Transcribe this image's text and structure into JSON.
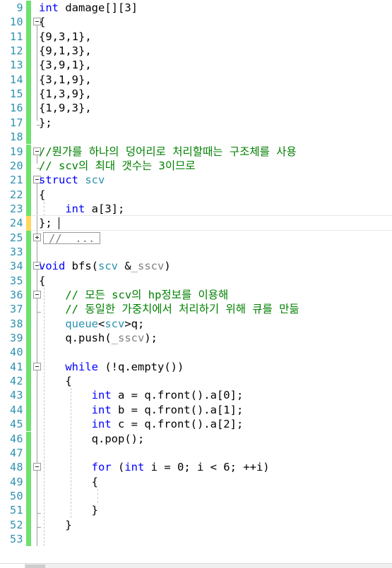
{
  "editor": {
    "first_line": 9,
    "line_height": 20.35,
    "colors": {
      "keyword": "#0000ff",
      "comment": "#008000",
      "type": "#2b91af",
      "parameter": "#808080",
      "text": "#000000",
      "line_number": "#2b91af",
      "change_saved": "#6ee26e",
      "change_unsaved": "#ffd75e",
      "background": "#ffffff"
    },
    "caret": {
      "line": 24,
      "column": 3
    },
    "scrollbar": {
      "orientation": "horizontal",
      "thumb_label": ""
    },
    "lines": [
      {
        "n": 9,
        "change": "green",
        "fold": null,
        "indent": 1,
        "tokens": [
          {
            "t": "int",
            "c": "kw"
          },
          {
            "t": " damage[][3]",
            "c": ""
          }
        ]
      },
      {
        "n": 10,
        "change": "green",
        "fold": "minus",
        "indent": 1,
        "tokens": [
          {
            "t": "{",
            "c": ""
          }
        ]
      },
      {
        "n": 11,
        "change": "green",
        "fold": null,
        "indent": 1,
        "tokens": [
          {
            "t": "{9,3,1},",
            "c": ""
          }
        ]
      },
      {
        "n": 12,
        "change": "green",
        "fold": null,
        "indent": 1,
        "tokens": [
          {
            "t": "{9,1,3},",
            "c": ""
          }
        ]
      },
      {
        "n": 13,
        "change": "green",
        "fold": null,
        "indent": 1,
        "tokens": [
          {
            "t": "{3,9,1},",
            "c": ""
          }
        ]
      },
      {
        "n": 14,
        "change": "green",
        "fold": null,
        "indent": 1,
        "tokens": [
          {
            "t": "{3,1,9},",
            "c": ""
          }
        ]
      },
      {
        "n": 15,
        "change": "green",
        "fold": null,
        "indent": 1,
        "tokens": [
          {
            "t": "{1,3,9},",
            "c": ""
          }
        ]
      },
      {
        "n": 16,
        "change": "green",
        "fold": null,
        "indent": 1,
        "tokens": [
          {
            "t": "{1,9,3},",
            "c": ""
          }
        ]
      },
      {
        "n": 17,
        "change": "green",
        "fold": "end",
        "indent": 1,
        "tokens": [
          {
            "t": "};",
            "c": ""
          }
        ]
      },
      {
        "n": 18,
        "change": "green",
        "fold": null,
        "indent": 0,
        "tokens": []
      },
      {
        "n": 19,
        "change": "green",
        "fold": "minus",
        "indent": 1,
        "tokens": [
          {
            "t": "//뭔가를 하나의 덩어리로 처리할때는 구조체를 사용",
            "c": "cm"
          }
        ]
      },
      {
        "n": 20,
        "change": "green",
        "fold": "end",
        "indent": 1,
        "tokens": [
          {
            "t": "// scv의 최대 갯수는 3이므로",
            "c": "cm"
          }
        ]
      },
      {
        "n": 21,
        "change": "green",
        "fold": "minus",
        "indent": 1,
        "tokens": [
          {
            "t": "struct",
            "c": "kw"
          },
          {
            "t": " ",
            "c": ""
          },
          {
            "t": "scv",
            "c": "ty"
          }
        ]
      },
      {
        "n": 22,
        "change": "green",
        "fold": null,
        "indent": 1,
        "tokens": [
          {
            "t": "{",
            "c": ""
          }
        ]
      },
      {
        "n": 23,
        "change": "green",
        "fold": null,
        "indent": 2,
        "tokens": [
          {
            "t": "    ",
            "c": ""
          },
          {
            "t": "int",
            "c": "kw"
          },
          {
            "t": " a[3];",
            "c": ""
          }
        ]
      },
      {
        "n": 24,
        "change": "yellow",
        "fold": null,
        "indent": 1,
        "current": true,
        "tokens": [
          {
            "t": "};",
            "c": ""
          }
        ]
      },
      {
        "n": 25,
        "change": "green",
        "fold": "plus",
        "indent": 0,
        "collapsed": "//  ...",
        "tokens": []
      },
      {
        "n": 33,
        "change": "green",
        "fold": null,
        "indent": 0,
        "tokens": []
      },
      {
        "n": 34,
        "change": "green",
        "fold": "minus",
        "indent": 1,
        "tokens": [
          {
            "t": "void",
            "c": "kw"
          },
          {
            "t": " bfs(",
            "c": ""
          },
          {
            "t": "scv",
            "c": "ty"
          },
          {
            "t": " &",
            "c": ""
          },
          {
            "t": "_sscv",
            "c": "pv"
          },
          {
            "t": ")",
            "c": ""
          }
        ]
      },
      {
        "n": 35,
        "change": "green",
        "fold": null,
        "indent": 1,
        "tokens": [
          {
            "t": "{",
            "c": ""
          }
        ]
      },
      {
        "n": 36,
        "change": "green",
        "fold": "minus",
        "indent": 2,
        "tokens": [
          {
            "t": "    ",
            "c": ""
          },
          {
            "t": "// 모든 scv의 hp정보를 이용해",
            "c": "cm"
          }
        ]
      },
      {
        "n": 37,
        "change": "green",
        "fold": "end",
        "indent": 2,
        "tokens": [
          {
            "t": "    ",
            "c": ""
          },
          {
            "t": "// 동일한 가중치에서 처리하기 위해 큐를 만듦",
            "c": "cm"
          }
        ]
      },
      {
        "n": 38,
        "change": "green",
        "fold": null,
        "indent": 2,
        "tokens": [
          {
            "t": "    ",
            "c": ""
          },
          {
            "t": "queue",
            "c": "ty"
          },
          {
            "t": "<",
            "c": ""
          },
          {
            "t": "scv",
            "c": "ty"
          },
          {
            "t": ">q;",
            "c": ""
          }
        ]
      },
      {
        "n": 39,
        "change": "green",
        "fold": null,
        "indent": 2,
        "tokens": [
          {
            "t": "    q.push(",
            "c": ""
          },
          {
            "t": "_sscv",
            "c": "pv"
          },
          {
            "t": ");",
            "c": ""
          }
        ]
      },
      {
        "n": 40,
        "change": "green",
        "fold": null,
        "indent": 2,
        "tokens": []
      },
      {
        "n": 41,
        "change": "green",
        "fold": "minus",
        "indent": 2,
        "tokens": [
          {
            "t": "    ",
            "c": ""
          },
          {
            "t": "while",
            "c": "kw"
          },
          {
            "t": " (!q.empty())",
            "c": ""
          }
        ]
      },
      {
        "n": 42,
        "change": "green",
        "fold": null,
        "indent": 2,
        "tokens": [
          {
            "t": "    {",
            "c": ""
          }
        ]
      },
      {
        "n": 43,
        "change": "green",
        "fold": null,
        "indent": 3,
        "tokens": [
          {
            "t": "        ",
            "c": ""
          },
          {
            "t": "int",
            "c": "kw"
          },
          {
            "t": " a = q.front().a[0];",
            "c": ""
          }
        ]
      },
      {
        "n": 44,
        "change": "green",
        "fold": null,
        "indent": 3,
        "tokens": [
          {
            "t": "        ",
            "c": ""
          },
          {
            "t": "int",
            "c": "kw"
          },
          {
            "t": " b = q.front().a[1];",
            "c": ""
          }
        ]
      },
      {
        "n": 45,
        "change": "green",
        "fold": null,
        "indent": 3,
        "tokens": [
          {
            "t": "        ",
            "c": ""
          },
          {
            "t": "int",
            "c": "kw"
          },
          {
            "t": " c = q.front().a[2];",
            "c": ""
          }
        ]
      },
      {
        "n": 46,
        "change": "green",
        "fold": null,
        "indent": 3,
        "tokens": [
          {
            "t": "        q.pop();",
            "c": ""
          }
        ]
      },
      {
        "n": 47,
        "change": "green",
        "fold": null,
        "indent": 3,
        "tokens": []
      },
      {
        "n": 48,
        "change": "green",
        "fold": "minus",
        "indent": 3,
        "tokens": [
          {
            "t": "        ",
            "c": ""
          },
          {
            "t": "for",
            "c": "kw"
          },
          {
            "t": " (",
            "c": ""
          },
          {
            "t": "int",
            "c": "kw"
          },
          {
            "t": " i = 0; i < 6; ++i)",
            "c": ""
          }
        ]
      },
      {
        "n": 49,
        "change": "green",
        "fold": null,
        "indent": 3,
        "tokens": [
          {
            "t": "        {",
            "c": ""
          }
        ]
      },
      {
        "n": 50,
        "change": "green",
        "fold": null,
        "indent": 4,
        "tokens": []
      },
      {
        "n": 51,
        "change": "green",
        "fold": "end",
        "indent": 3,
        "tokens": [
          {
            "t": "        }",
            "c": ""
          }
        ]
      },
      {
        "n": 52,
        "change": "green",
        "fold": "end",
        "indent": 2,
        "tokens": [
          {
            "t": "    }",
            "c": ""
          }
        ]
      },
      {
        "n": 53,
        "change": "green",
        "fold": null,
        "indent": 2,
        "tokens": []
      }
    ]
  }
}
